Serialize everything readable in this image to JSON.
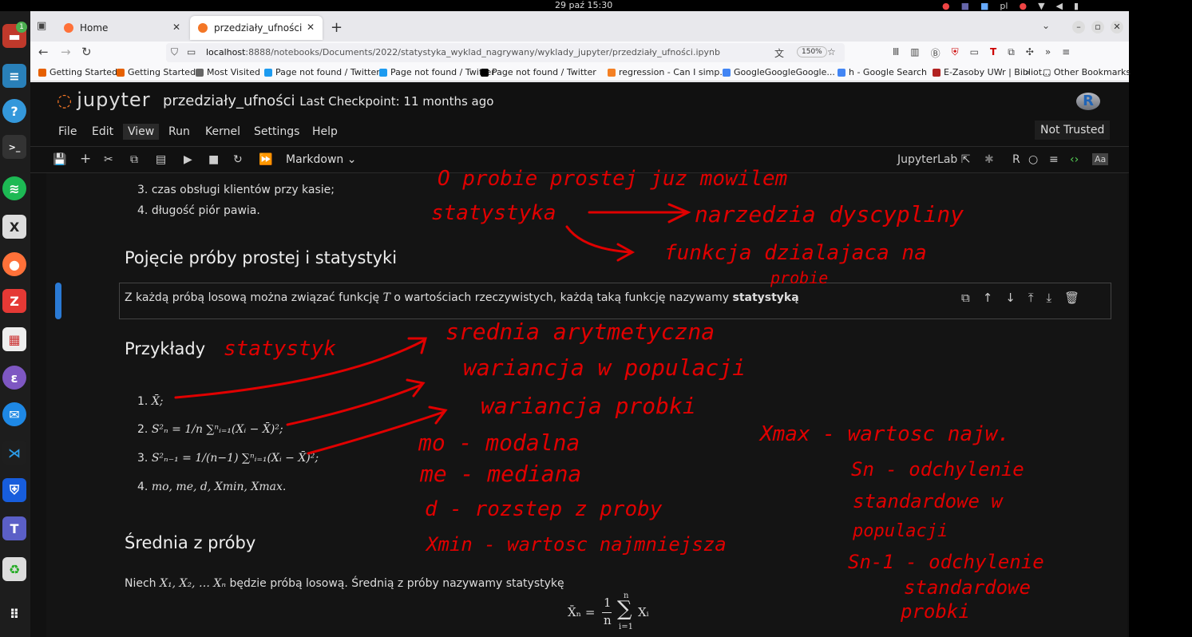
{
  "system": {
    "clock": "29 paź  15:30",
    "language": "pl"
  },
  "browser": {
    "tabs": [
      {
        "label": "Home",
        "active": false
      },
      {
        "label": "przedziały_ufności",
        "active": true
      }
    ],
    "url_host": "localhost",
    "url_path": ":8888/notebooks/Documents/2022/statystyka_wyklad_nagrywany/wyklady_jupyter/przedziały_ufności.ipynb",
    "zoom": "150%",
    "bookmarks": [
      {
        "label": "Getting Started",
        "color": "#e66000"
      },
      {
        "label": "Getting Started",
        "color": "#e66000"
      },
      {
        "label": "Most Visited",
        "color": "#666666"
      },
      {
        "label": "Page not found / Twitter",
        "color": "#1d9bf0"
      },
      {
        "label": "Page not found / Twitter",
        "color": "#1d9bf0"
      },
      {
        "label": "Page not found / Twitter",
        "color": "#000000"
      },
      {
        "label": "regression - Can I simp...",
        "color": "#f48024"
      },
      {
        "label": "GoogleGoogleGoogle...",
        "color": "#4285f4"
      },
      {
        "label": "h - Google Search",
        "color": "#4285f4"
      },
      {
        "label": "E-Zasoby UWr | Bibliot...",
        "color": "#b22222"
      }
    ],
    "bookmarks_more": "»",
    "other_bookmarks": "Other Bookmarks"
  },
  "jupyter": {
    "logo_text": "jupyter",
    "notebook_name": "przedziały_ufności",
    "checkpoint": "Last Checkpoint: 11 months ago",
    "menu": [
      "File",
      "Edit",
      "View",
      "Run",
      "Kernel",
      "Settings",
      "Help"
    ],
    "active_menu": "View",
    "trust": "Not Trusted",
    "cell_type": "Markdown",
    "jupyterlab_label": "JupyterLab",
    "kernel_name": "R",
    "kernel_logo": "R"
  },
  "notebook": {
    "list_items": [
      {
        "num": "3.",
        "text": "czas obsługi klientów przy kasie;"
      },
      {
        "num": "4.",
        "text": "długość piór pawia."
      }
    ],
    "heading1": "Pojęcie próby prostej i statystyki",
    "active_cell_text": "Z każdą próbą losową można związać funkcję ",
    "active_cell_var": "T",
    "active_cell_text2": " o wartościach rzeczywistych, każdą taką funkcję nazywamy ",
    "active_cell_bold": "statystyką",
    "heading2": "Przykłady",
    "examples": [
      {
        "num": "1.",
        "text": "X̄;"
      },
      {
        "num": "2.",
        "text": "S²ₙ = 1/n ∑ⁿᵢ₌₁(Xᵢ − X̄)²;"
      },
      {
        "num": "3.",
        "text": "S²ₙ₋₁ = 1/(n−1) ∑ⁿᵢ₌₁(Xᵢ − X̄)²;"
      },
      {
        "num": "4.",
        "text": "mo, me, d, Xmin, Xmax."
      }
    ],
    "heading3": "Średnia z próby",
    "mean_text_pre": "Niech ",
    "mean_vars": "X₁, X₂, … Xₙ",
    "mean_text_post": " będzie próbą losową. Średnią z próby nazywamy statystykę",
    "formula_lhs": "X̄ₙ =",
    "formula_frac_num": "1",
    "formula_frac_den": "n",
    "formula_sum_top": "n",
    "formula_sum_bottom": "i=1",
    "formula_rhs": "Xᵢ"
  },
  "annotations": {
    "color": "#e00000",
    "lines": [
      "O probie prostej juz mowilem",
      "statystyka",
      "narzedzia dyscypliny",
      "funkcja dzialajaca na",
      "probie",
      "statystyk",
      "srednia arytmetyczna",
      "wariancja w populacji",
      "wariancja probki",
      "mo - modalna",
      "me - mediana",
      "d - rozstep z proby",
      "Xmin - wartosc najmniejsza",
      "Xmax - wartosc najw.",
      "Sn - odchylenie",
      "standardowe w",
      "populacji",
      "Sn-1 - odchylenie",
      "standardowe",
      "probki"
    ]
  }
}
